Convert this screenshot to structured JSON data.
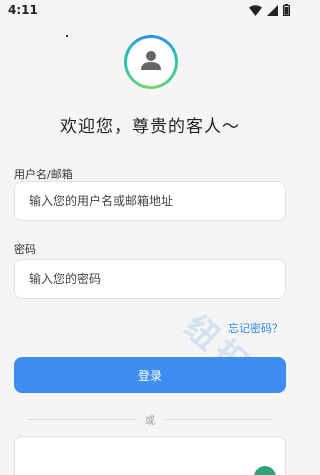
{
  "status_bar": {
    "time": "4:11",
    "wifi_icon": "wifi-icon",
    "signal_icon": "signal-icon",
    "battery_icon": "battery-icon"
  },
  "avatar": {
    "icon": "user-icon"
  },
  "welcome_text": "欢迎您，尊贵的客人～",
  "username": {
    "label": "用户名/邮箱",
    "placeholder": "输入您的用户名或邮箱地址",
    "value": ""
  },
  "password": {
    "label": "密码",
    "placeholder": "输入您的密码",
    "value": ""
  },
  "forgot_password": "忘记密码？",
  "login_button": "登录",
  "divider_text": "或",
  "watermark_text": "纽扣",
  "colors": {
    "accent": "#3d8ef0",
    "link": "#2a86f5",
    "background": "#f5f5f5"
  }
}
